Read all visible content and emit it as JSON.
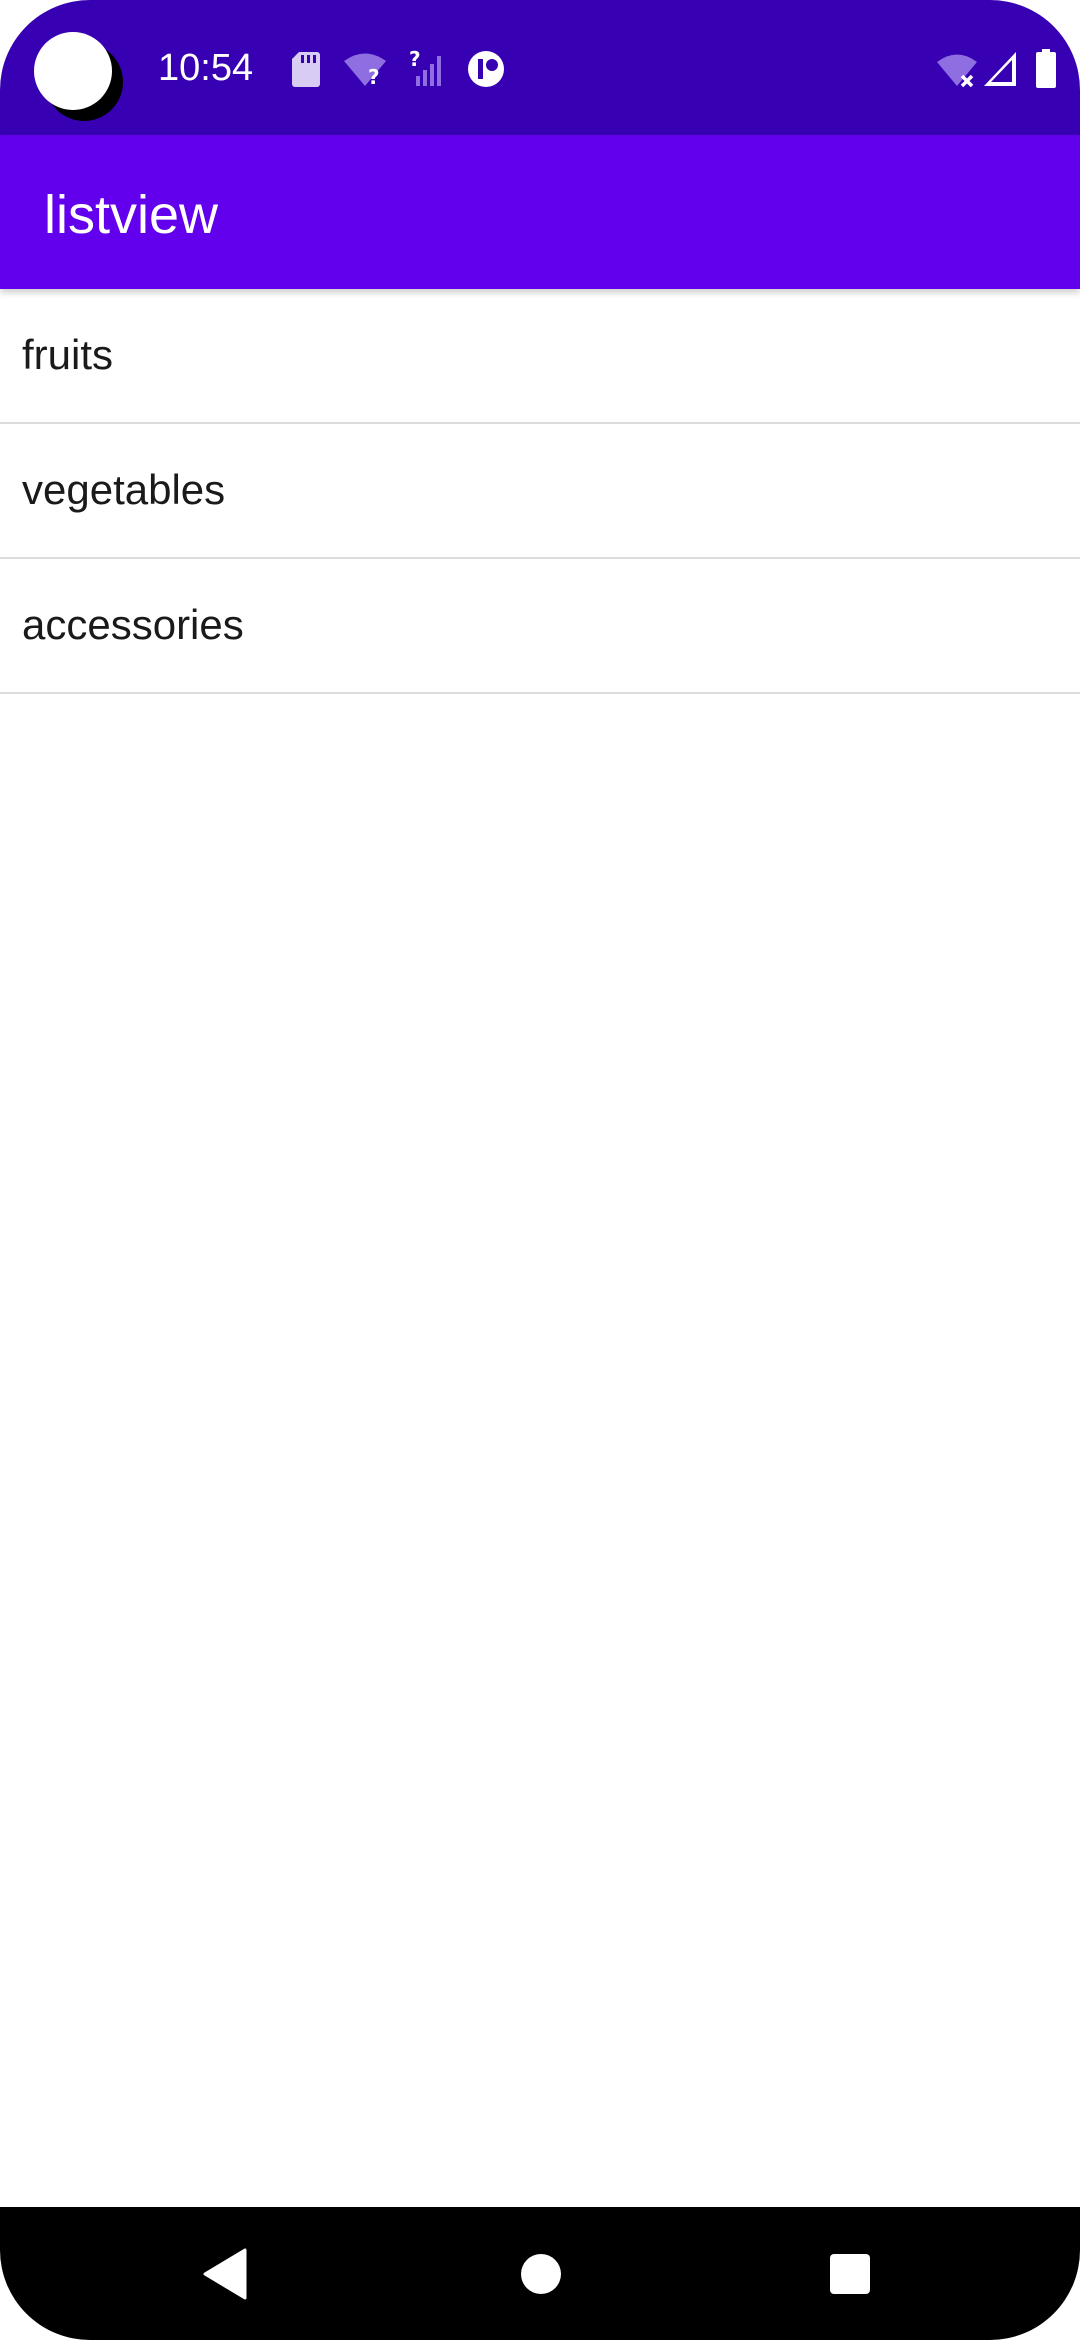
{
  "status_bar": {
    "time": "10:54",
    "icons": [
      "sd-card-icon",
      "wifi-unknown-icon",
      "signal-unknown-icon",
      "app-notification-icon",
      "wifi-off-icon",
      "cell-signal-icon",
      "battery-icon"
    ]
  },
  "app_bar": {
    "title": "listview",
    "color": "#6200ee",
    "status_color": "#3700b3"
  },
  "list": {
    "items": [
      {
        "label": "fruits"
      },
      {
        "label": "vegetables"
      },
      {
        "label": "accessories"
      }
    ]
  },
  "nav_bar": {
    "buttons": [
      "back-icon",
      "home-icon",
      "recents-icon"
    ]
  }
}
